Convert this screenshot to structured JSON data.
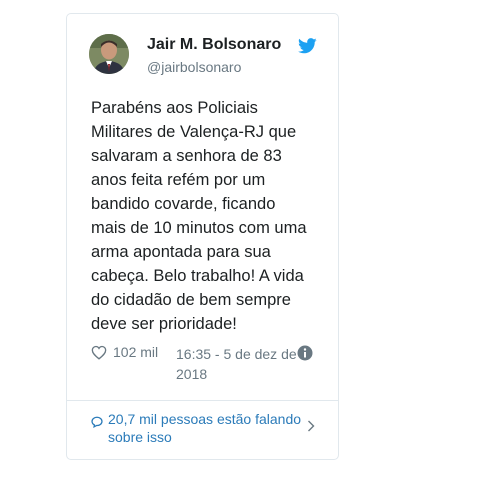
{
  "author": {
    "name": "Jair M. Bolsonaro",
    "handle": "@jairbolsonaro",
    "avatar_icon": "profile-photo",
    "verified_icon": "twitter-bird-icon"
  },
  "tweet": {
    "text": "Parabéns aos Policiais\nMilitares de Valença-RJ que\nsalvaram a senhora de 83\nanos feita refém por um\nbandido covarde, ficando\nmais de 10 minutos com uma\narma apontada para sua\ncabeça. Belo trabalho! A vida\ndo cidadão de bem sempre\ndeve ser prioridade!"
  },
  "meta": {
    "likes": "102 mil",
    "timestamp": "16:35 - 5 de dez de 2018"
  },
  "conversation": {
    "label": "20,7 mil pessoas estão falando sobre isso"
  },
  "colors": {
    "twitter_blue": "#1da1f2",
    "link_blue": "#2b7bb9",
    "muted": "#697882",
    "border": "#e1e8ed"
  }
}
